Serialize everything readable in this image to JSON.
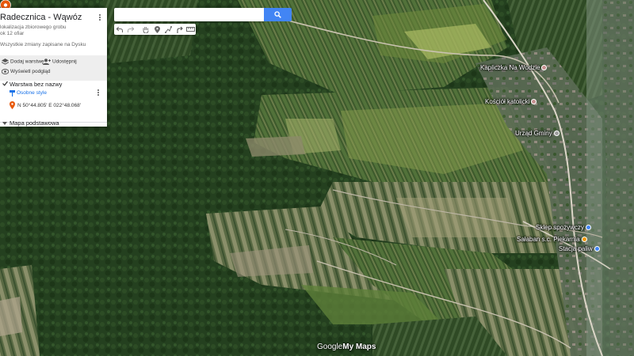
{
  "panel": {
    "map_title": "Radecznica - Wąwóz",
    "description_line1": "lokalizacja zbiorowego grobu",
    "description_line2": "ok 12 ofiar",
    "saved_status": "Wszystkie zmiany zapisane na Dysku",
    "add_layer_label": "Dodaj warstwę",
    "share_label": "Udostępnij",
    "preview_label": "Wyświetl podgląd",
    "layer": {
      "name": "Warstwa bez nazwy",
      "style_label": "Osobne style",
      "coordinates": "N 50°44.805' E 022°48.068'"
    },
    "base_map_label": "Mapa podstawowa"
  },
  "search": {
    "value": "",
    "placeholder": ""
  },
  "toolbar": {
    "tools": [
      "undo-icon",
      "redo-icon",
      "hand-icon",
      "add-marker-icon",
      "draw-line-icon",
      "directions-icon",
      "ruler-icon"
    ]
  },
  "map": {
    "places": {
      "kapliczka": "Kapliczka Na Wodzie",
      "kosciol": "Kościół katolicki",
      "urzad": "Urząd Gminy",
      "sklep": "Sklep spożywczy",
      "salaban": "Sałaban s.c. Piekarnia",
      "stacja": "Stacja paliw"
    },
    "marker_color": "#e8590c",
    "poi_colors": {
      "worship": "#c58f8f",
      "government": "#9e9e9e",
      "shop": "#4285f4",
      "food": "#f29900"
    }
  },
  "branding": {
    "google": "Google",
    "mymaps": "My Maps"
  }
}
